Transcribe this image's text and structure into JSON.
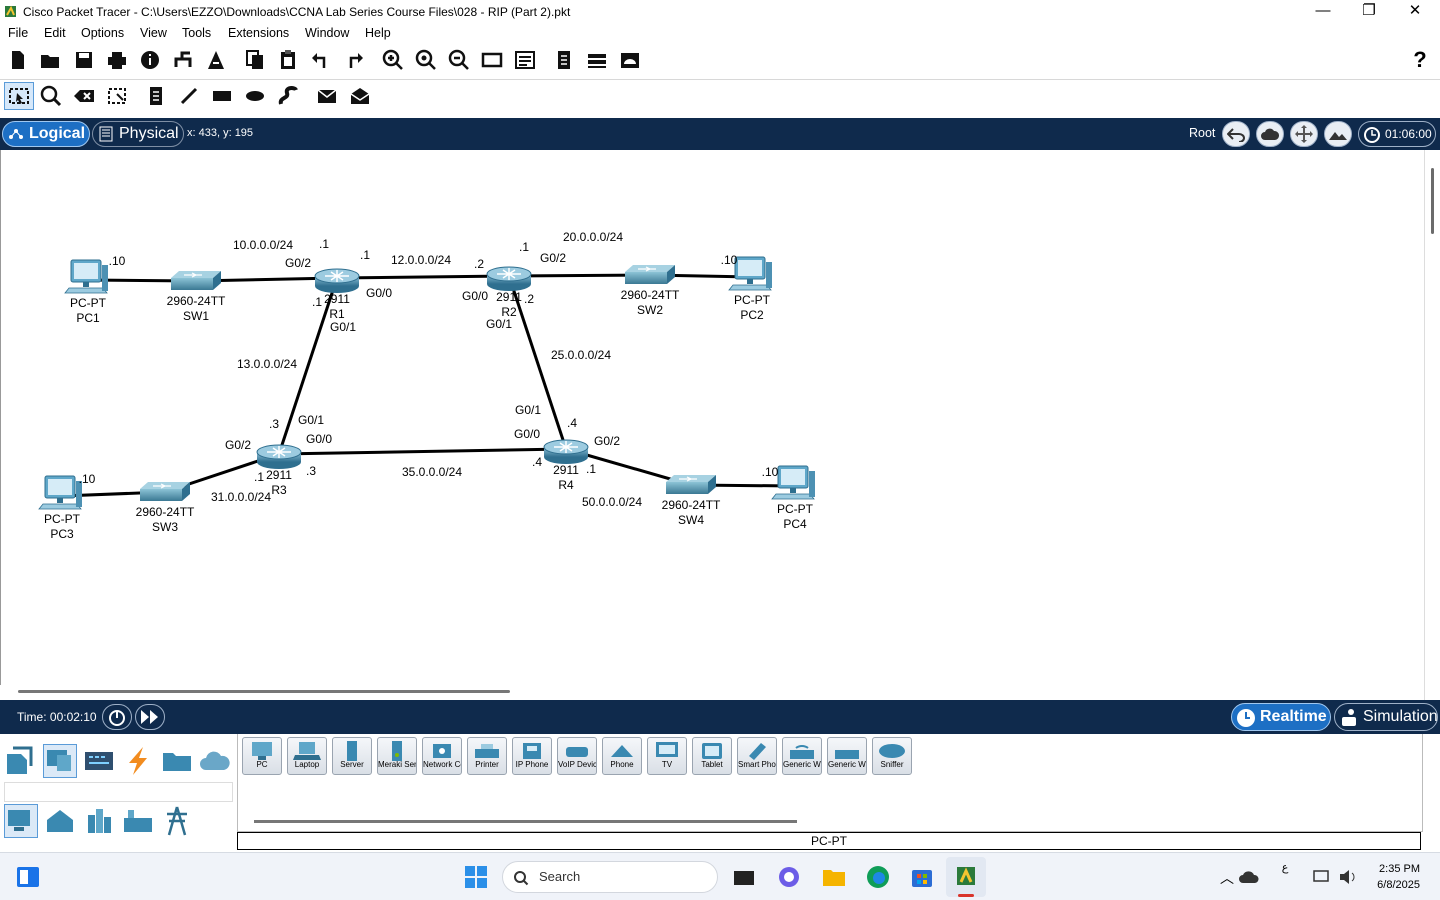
{
  "window": {
    "title": "Cisco Packet Tracer - C:\\Users\\EZZO\\Downloads\\CCNA Lab Series Course Files\\028 - RIP (Part 2).pkt"
  },
  "menu": [
    "File",
    "Edit",
    "Options",
    "View",
    "Tools",
    "Extensions",
    "Window",
    "Help"
  ],
  "nav": {
    "logical": "Logical",
    "physical": "Physical",
    "coords": "x: 433, y: 195",
    "root": "Root",
    "clock": "01:06:00"
  },
  "timebar": {
    "time": "Time: 00:02:10",
    "realtime": "Realtime",
    "simulation": "Simulation"
  },
  "topology": {
    "devices": [
      {
        "id": "pc1",
        "type": "pc",
        "model": "PC-PT",
        "name": "PC1"
      },
      {
        "id": "sw1",
        "type": "switch",
        "model": "2960-24TT",
        "name": "SW1"
      },
      {
        "id": "r1",
        "type": "router",
        "model": "2911",
        "name": "R1"
      },
      {
        "id": "r2",
        "type": "router",
        "model": "2911",
        "name": "R2"
      },
      {
        "id": "sw2",
        "type": "switch",
        "model": "2960-24TT",
        "name": "SW2"
      },
      {
        "id": "pc2",
        "type": "pc",
        "model": "PC-PT",
        "name": "PC2"
      },
      {
        "id": "r3",
        "type": "router",
        "model": "2911",
        "name": "R3"
      },
      {
        "id": "r4",
        "type": "router",
        "model": "2911",
        "name": "R4"
      },
      {
        "id": "pc3",
        "type": "pc",
        "model": "PC-PT",
        "name": "PC3"
      },
      {
        "id": "sw3",
        "type": "switch",
        "model": "2960-24TT",
        "name": "SW3"
      },
      {
        "id": "sw4",
        "type": "switch",
        "model": "2960-24TT",
        "name": "SW4"
      },
      {
        "id": "pc4",
        "type": "pc",
        "model": "PC-PT",
        "name": "PC4"
      }
    ],
    "links": [
      {
        "from": "pc1",
        "to": "sw1"
      },
      {
        "from": "sw1",
        "to": "r1"
      },
      {
        "from": "r1",
        "to": "r2"
      },
      {
        "from": "r2",
        "to": "sw2"
      },
      {
        "from": "sw2",
        "to": "pc2"
      },
      {
        "from": "r1",
        "to": "r3"
      },
      {
        "from": "r2",
        "to": "r4"
      },
      {
        "from": "r3",
        "to": "r4"
      },
      {
        "from": "pc3",
        "to": "sw3"
      },
      {
        "from": "sw3",
        "to": "r3"
      },
      {
        "from": "r4",
        "to": "sw4"
      },
      {
        "from": "sw4",
        "to": "pc4"
      }
    ],
    "labels": [
      "10.0.0.0/24",
      ".1",
      ".1",
      "12.0.0.0/24",
      ".1",
      "20.0.0.0/24",
      ".10",
      "G0/2",
      "G0/0",
      ".2",
      "G0/0",
      "G0/2",
      ".10",
      ".1",
      "G0/1",
      ".2",
      "G0/1",
      "13.0.0.0/24",
      "25.0.0.0/24",
      ".3",
      "G0/1",
      "G0/1",
      ".4",
      "G0/2",
      "G0/0",
      "G0/0",
      "G0/2",
      ".4",
      ".1",
      ".3",
      "35.0.0.0/24",
      ".10",
      ".1",
      "31.0.0.0/24",
      "50.0.0.0/24",
      ".10"
    ]
  },
  "device_categories": [
    "network-devices",
    "end-devices",
    "components",
    "connections",
    "miscellaneous",
    "multiuser"
  ],
  "end_devices": [
    "PC",
    "Laptop",
    "Server",
    "Meraki Server",
    "Network Controller",
    "Printer",
    "IP Phone",
    "VoIP Device",
    "Phone",
    "TV",
    "Tablet",
    "Smart Phone",
    "Generic Wireless",
    "Generic Wired",
    "Sniffer"
  ],
  "selected_device": "PC-PT",
  "taskbar": {
    "search": "Search",
    "time": "2:35 PM",
    "date": "6/8/2025",
    "lang": "ع"
  }
}
